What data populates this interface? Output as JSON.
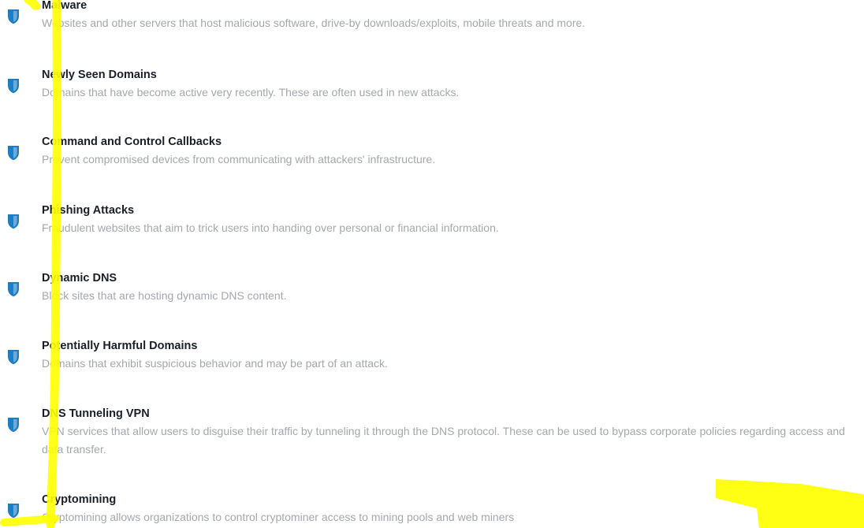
{
  "colors": {
    "shield_accent": "#1f7dc2",
    "title_text": "#1a1f27",
    "description_text": "#a4a7ac",
    "highlight_marker": "#ffff00"
  },
  "categories": [
    {
      "icon": "shield-icon",
      "title": "Malware",
      "description": "Websites and other servers that host malicious software, drive-by downloads/exploits, mobile threats and more."
    },
    {
      "icon": "shield-icon",
      "title": "Newly Seen Domains",
      "description": "Domains that have become active very recently. These are often used in new attacks."
    },
    {
      "icon": "shield-icon",
      "title": "Command and Control Callbacks",
      "description": "Prevent compromised devices from communicating with attackers' infrastructure."
    },
    {
      "icon": "shield-icon",
      "title": "Phishing Attacks",
      "description": "Fraudulent websites that aim to trick users into handing over personal or financial information."
    },
    {
      "icon": "shield-icon",
      "title": "Dynamic DNS",
      "description": "Block sites that are hosting dynamic DNS content."
    },
    {
      "icon": "shield-icon",
      "title": "Potentially Harmful Domains",
      "description": "Domains that exhibit suspicious behavior and may be part of an attack."
    },
    {
      "icon": "shield-icon",
      "title": "DNS Tunneling VPN",
      "description": "VPN services that allow users to disguise their traffic by tunneling it through the DNS protocol. These can be used to bypass corporate policies regarding access and data transfer."
    },
    {
      "icon": "shield-icon",
      "title": "Cryptomining",
      "description": "Cryptomining allows organizations to control cryptominer access to mining pools and web miners"
    }
  ]
}
